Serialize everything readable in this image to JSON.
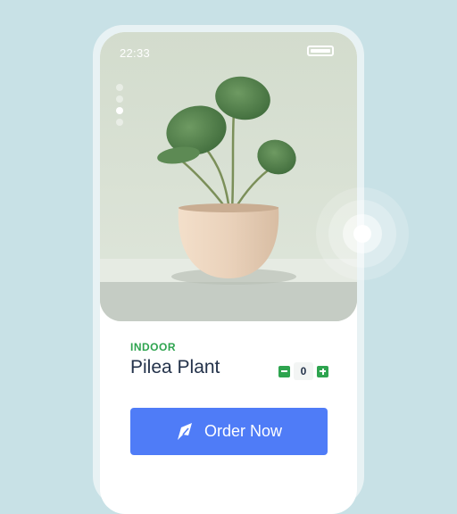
{
  "status_bar": {
    "time": "22:33",
    "battery_icon": "battery-full-icon"
  },
  "carousel": {
    "count": 4,
    "active_index": 2
  },
  "product": {
    "category": "INDOOR",
    "name": "Pilea Plant",
    "quantity": "0",
    "decrease_icon": "minus-icon",
    "increase_icon": "plus-icon"
  },
  "order_button": {
    "label": "Order Now",
    "icon": "rocket-icon"
  },
  "colors": {
    "background": "#c8e1e6",
    "accent_green": "#2ea44f",
    "button_blue": "#4f7cf7",
    "title_text": "#23324a"
  }
}
